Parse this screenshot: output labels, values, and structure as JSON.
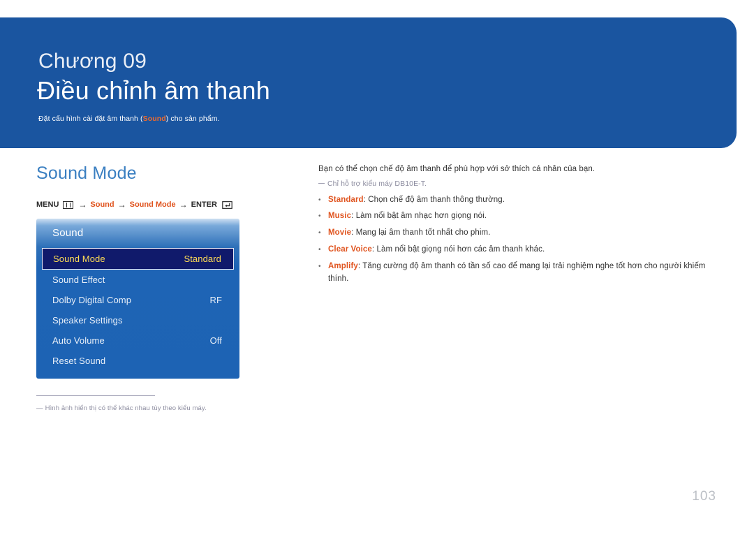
{
  "header": {
    "chapter_number": "Chương 09",
    "chapter_title": "Điều chỉnh âm thanh",
    "subtitle_before": "Đặt cấu hình cài đặt âm thanh (",
    "subtitle_highlight": "Sound",
    "subtitle_after": ") cho sản phẩm.",
    "banner_color": "#1a55a0",
    "highlight_color": "#ef6a2c"
  },
  "section": {
    "heading": "Sound Mode",
    "heading_color": "#3a7fc1"
  },
  "menu_path": {
    "menu_label": "MENU",
    "menu_icon": "menu-bars-icon",
    "arrow": "→",
    "step_1": "Sound",
    "step_2": "Sound Mode",
    "enter_label": "ENTER",
    "enter_icon": "enter-return-icon",
    "accent_color": "#e0541f"
  },
  "osd": {
    "title": "Sound",
    "rows": [
      {
        "label": "Sound Mode",
        "value": "Standard",
        "selected": true
      },
      {
        "label": "Sound Effect",
        "value": "",
        "selected": false
      },
      {
        "label": "Dolby Digital Comp",
        "value": "RF",
        "selected": false
      },
      {
        "label": "Speaker Settings",
        "value": "",
        "selected": false
      },
      {
        "label": "Auto Volume",
        "value": "Off",
        "selected": false
      },
      {
        "label": "Reset Sound",
        "value": "",
        "selected": false
      }
    ],
    "selected_bg": "#101a6b",
    "selected_text": "#ffdd55"
  },
  "footnote": {
    "dash": "―",
    "text": "Hình ảnh hiển thị có thể khác nhau tùy theo kiểu máy."
  },
  "content": {
    "lead": "Bạn có thể chọn chế độ âm thanh để phù hợp với sở thích cá nhân của bạn.",
    "note": "Chỉ hỗ trợ kiểu máy DB10E-T.",
    "bullet_char": "•",
    "bullets": [
      {
        "term": "Standard",
        "sep": ": ",
        "desc": "Chọn chế độ âm thanh thông thường."
      },
      {
        "term": "Music",
        "sep": ": ",
        "desc": "Làm nổi bật âm nhạc hơn giọng nói."
      },
      {
        "term": "Movie",
        "sep": ": ",
        "desc": "Mang lại âm thanh tốt nhất cho phim."
      },
      {
        "term": "Clear Voice",
        "sep": ": ",
        "desc": "Làm nổi bật giọng nói hơn các âm thanh khác."
      },
      {
        "term": "Amplify",
        "sep": ": ",
        "desc": "Tăng cường độ âm thanh có tần số cao để mang lại trải nghiệm nghe tốt hơn cho người khiếm thính."
      }
    ]
  },
  "page_number": "103"
}
